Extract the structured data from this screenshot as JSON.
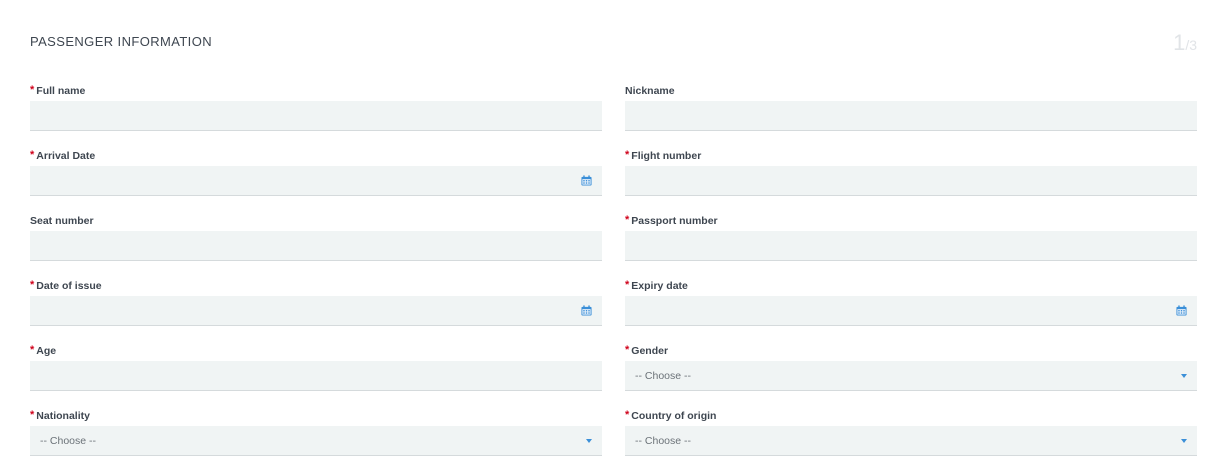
{
  "header": {
    "title": "PASSENGER INFORMATION",
    "step_current": "1",
    "step_separator": "/",
    "step_total": "3"
  },
  "colors": {
    "required": "#d0021b",
    "accent": "#3b8fd8",
    "field_bg": "#f0f4f4"
  },
  "fields": {
    "full_name": {
      "label": "Full name",
      "required": true,
      "value": ""
    },
    "nickname": {
      "label": "Nickname",
      "required": false,
      "value": ""
    },
    "arrival_date": {
      "label": "Arrival Date",
      "required": true,
      "value": ""
    },
    "flight_number": {
      "label": "Flight number",
      "required": true,
      "value": ""
    },
    "seat_number": {
      "label": "Seat number",
      "required": false,
      "value": ""
    },
    "passport_number": {
      "label": "Passport number",
      "required": true,
      "value": ""
    },
    "date_of_issue": {
      "label": "Date of issue",
      "required": true,
      "value": ""
    },
    "expiry_date": {
      "label": "Expiry date",
      "required": true,
      "value": ""
    },
    "age": {
      "label": "Age",
      "required": true,
      "value": ""
    },
    "gender": {
      "label": "Gender",
      "required": true,
      "value": "-- Choose --"
    },
    "nationality": {
      "label": "Nationality",
      "required": true,
      "value": "-- Choose --"
    },
    "country_of_origin": {
      "label": "Country of origin",
      "required": true,
      "value": "-- Choose --"
    }
  },
  "required_marker": "*",
  "icons": {
    "calendar": "calendar-icon",
    "dropdown": "chevron-down-icon"
  }
}
